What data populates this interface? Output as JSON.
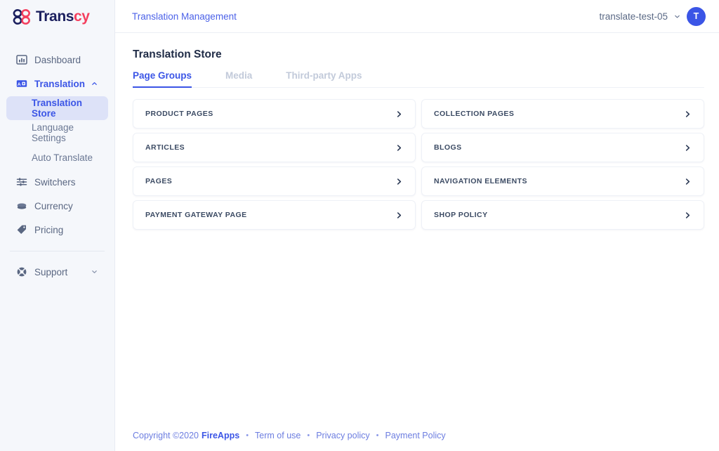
{
  "brand": {
    "name_part1": "Trans",
    "name_part2": "cy",
    "logo_icon": "transcy-knot-logo",
    "color_navy": "#1b1f5e",
    "color_red": "#f43f5e"
  },
  "sidebar": {
    "items": [
      {
        "label": "Dashboard",
        "icon": "chart-bar-icon",
        "type": "item"
      },
      {
        "label": "Translation",
        "icon": "translate-icon",
        "type": "item",
        "accent": true,
        "caret": "chevron-up-icon"
      },
      {
        "label": "Translation Store",
        "type": "sub",
        "active": true
      },
      {
        "label": "Language Settings",
        "type": "sub",
        "active": false
      },
      {
        "label": "Auto Translate",
        "type": "sub",
        "active": false
      },
      {
        "label": "Switchers",
        "icon": "sliders-icon",
        "type": "item"
      },
      {
        "label": "Currency",
        "icon": "coin-stack-icon",
        "type": "item"
      },
      {
        "label": "Pricing",
        "icon": "tag-icon",
        "type": "item"
      },
      {
        "label": "Support",
        "icon": "life-buoy-icon",
        "type": "item",
        "caret": "chevron-down-icon",
        "divider_above": true
      }
    ]
  },
  "topbar": {
    "breadcrumb": "Translation Management",
    "account_name": "translate-test-05",
    "account_caret": "chevron-down-icon",
    "avatar_initial": "T",
    "avatar_color": "#3b55e6"
  },
  "main": {
    "page_title": "Translation Store",
    "tabs": [
      {
        "label": "Page Groups",
        "active": true
      },
      {
        "label": "Media",
        "active": false
      },
      {
        "label": "Third-party Apps",
        "active": false
      }
    ],
    "cards": [
      {
        "label": "PRODUCT PAGES",
        "chevron": "chevron-right-icon"
      },
      {
        "label": "COLLECTION PAGES",
        "chevron": "chevron-right-icon"
      },
      {
        "label": "ARTICLES",
        "chevron": "chevron-right-icon"
      },
      {
        "label": "BLOGS",
        "chevron": "chevron-right-icon"
      },
      {
        "label": "PAGES",
        "chevron": "chevron-right-icon"
      },
      {
        "label": "NAVIGATION ELEMENTS",
        "chevron": "chevron-right-icon"
      },
      {
        "label": "PAYMENT GATEWAY PAGE",
        "chevron": "chevron-right-icon"
      },
      {
        "label": "SHOP POLICY",
        "chevron": "chevron-right-icon"
      }
    ]
  },
  "footer": {
    "copyright": "Copyright ©2020",
    "brand": "FireApps",
    "links": [
      "Term of use",
      "Privacy policy",
      "Payment Policy"
    ],
    "separator": "•"
  }
}
